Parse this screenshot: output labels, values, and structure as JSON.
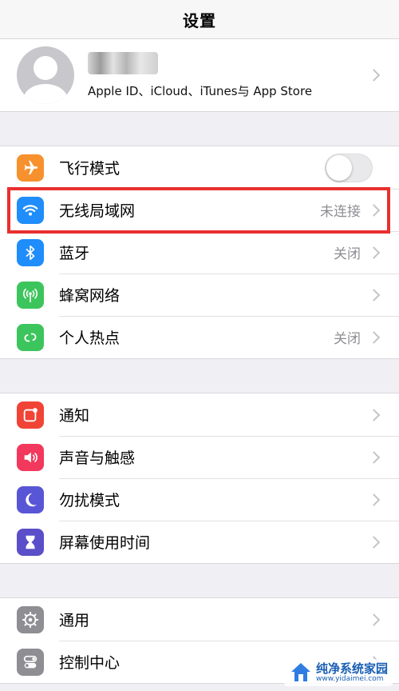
{
  "navbar": {
    "title": "设置"
  },
  "profile": {
    "subtitle": "Apple ID、iCloud、iTunes与 App Store"
  },
  "groups": [
    {
      "items": [
        {
          "label": "飞行模式",
          "icon": "airplane-icon",
          "color": "#f7912e",
          "toggle": false
        },
        {
          "label": "无线局域网",
          "icon": "wifi-icon",
          "color": "#1f8dfb",
          "value": "未连接",
          "highlighted": true
        },
        {
          "label": "蓝牙",
          "icon": "bluetooth-icon",
          "color": "#1f8dfb",
          "value": "关闭"
        },
        {
          "label": "蜂窝网络",
          "icon": "cellular-icon",
          "color": "#3cc55c",
          "value": ""
        },
        {
          "label": "个人热点",
          "icon": "hotspot-icon",
          "color": "#3cc55c",
          "value": "关闭"
        }
      ]
    },
    {
      "items": [
        {
          "label": "通知",
          "icon": "notification-icon",
          "color": "#f04436"
        },
        {
          "label": "声音与触感",
          "icon": "speaker-icon",
          "color": "#f2385c"
        },
        {
          "label": "勿扰模式",
          "icon": "moon-icon",
          "color": "#5856d6"
        },
        {
          "label": "屏幕使用时间",
          "icon": "hourglass-icon",
          "color": "#5a4fc9"
        }
      ]
    },
    {
      "items": [
        {
          "label": "通用",
          "icon": "gear-icon",
          "color": "#8e8e93"
        },
        {
          "label": "控制中心",
          "icon": "switches-icon",
          "color": "#8e8e93"
        }
      ]
    }
  ],
  "highlight_color": "#e8302f",
  "watermark": {
    "name": "纯净系统家园",
    "url": "www.yidaimei.com"
  }
}
